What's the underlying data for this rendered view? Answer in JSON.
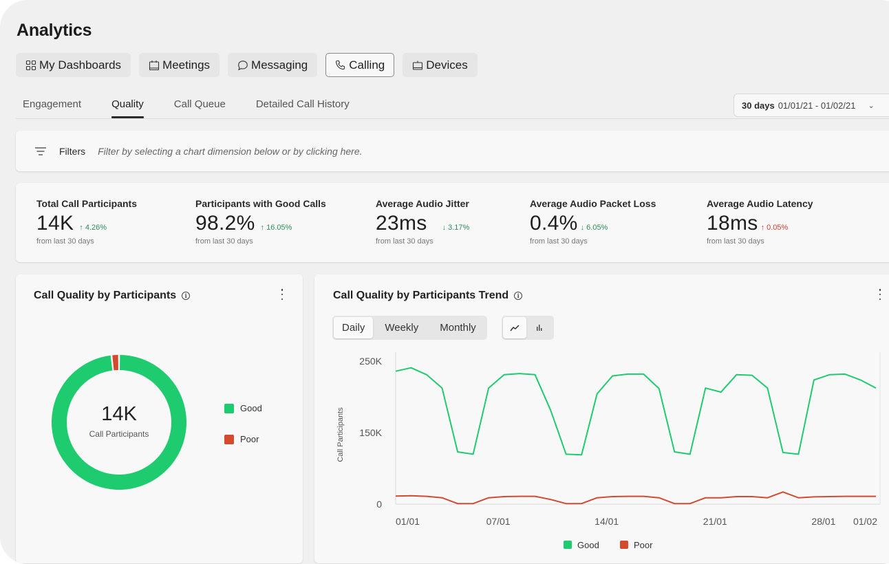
{
  "page": {
    "title": "Analytics"
  },
  "topnav": [
    {
      "label": "My Dashboards",
      "icon": "grid-icon",
      "active": false
    },
    {
      "label": "Meetings",
      "icon": "calendar-icon",
      "active": false
    },
    {
      "label": "Messaging",
      "icon": "chat-bubble-icon",
      "active": false
    },
    {
      "label": "Calling",
      "icon": "phone-icon",
      "active": true
    },
    {
      "label": "Devices",
      "icon": "device-icon",
      "active": false
    }
  ],
  "subtabs": [
    {
      "label": "Engagement",
      "active": false
    },
    {
      "label": "Quality",
      "active": true
    },
    {
      "label": "Call Queue",
      "active": false
    },
    {
      "label": "Detailed Call History",
      "active": false
    }
  ],
  "daterange": {
    "period": "30 days",
    "range": "01/01/21 - 01/02/21",
    "icon": "chevron-down-icon"
  },
  "filters": {
    "label": "Filters",
    "hint": "Filter by selecting a chart dimension below or by clicking here.",
    "icon": "filter-lines-icon"
  },
  "kpis": [
    {
      "label": "Total Call Participants",
      "value": "14K",
      "delta": "↑ 4.26%",
      "trend": "good",
      "sub": "from last 30 days"
    },
    {
      "label": "Participants with Good Calls",
      "value": "98.2%",
      "delta": "↑ 16.05%",
      "trend": "good",
      "sub": "from last 30 days"
    },
    {
      "label": "Average Audio Jitter",
      "value": "23ms",
      "delta": "↓ 3.17%",
      "trend": "good",
      "sub": "from last 30 days"
    },
    {
      "label": "Average Audio Packet Loss",
      "value": "0.4%",
      "delta": "↓ 6.05%",
      "trend": "good",
      "sub": "from last 30 days"
    },
    {
      "label": "Average Audio Latency",
      "value": "18ms",
      "delta": "↑ 0.05%",
      "trend": "bad",
      "sub": "from last 30 days"
    }
  ],
  "colors": {
    "good": "#1ecb6e",
    "poor": "#d44a2f",
    "delta_good": "#2e8b57",
    "delta_bad": "#c8412e"
  },
  "donut_card": {
    "title": "Call Quality by Participants",
    "center_value": "14K",
    "center_label": "Call Participants",
    "legend": [
      {
        "label": "Good",
        "color": "#1ecb6e"
      },
      {
        "label": "Poor",
        "color": "#d44a2f"
      }
    ]
  },
  "trend_card": {
    "title": "Call Quality by Participants Trend",
    "period_buttons": [
      {
        "label": "Daily",
        "active": true
      },
      {
        "label": "Weekly",
        "active": false
      },
      {
        "label": "Monthly",
        "active": false
      }
    ],
    "chart_type_buttons": [
      {
        "icon": "line-chart-icon",
        "active": true
      },
      {
        "icon": "bar-chart-icon",
        "active": false
      }
    ],
    "legend": [
      {
        "label": "Good",
        "color": "#1ecb6e"
      },
      {
        "label": "Poor",
        "color": "#d44a2f"
      }
    ]
  },
  "chart_data": [
    {
      "type": "pie",
      "title": "Call Quality by Participants",
      "categories": [
        "Good",
        "Poor"
      ],
      "values": [
        98.2,
        1.8
      ],
      "unit": "%",
      "center_text": "14K Call Participants",
      "legend": "right"
    },
    {
      "type": "line",
      "title": "Call Quality by Participants Trend",
      "xlabel": "",
      "ylabel": "Call Participants",
      "ylim": [
        0,
        250000
      ],
      "yticks": [
        0,
        150000,
        250000
      ],
      "ytick_labels": [
        "0",
        "150K",
        "250K"
      ],
      "xtick_labels": [
        "01/01",
        "07/01",
        "14/01",
        "21/01",
        "28/01",
        "01/02"
      ],
      "xtick_index": [
        0,
        6,
        13,
        20,
        27,
        31
      ],
      "x": [
        "01/01",
        "02/01",
        "03/01",
        "04/01",
        "05/01",
        "06/01",
        "07/01",
        "08/01",
        "09/01",
        "10/01",
        "11/01",
        "12/01",
        "13/01",
        "14/01",
        "15/01",
        "16/01",
        "17/01",
        "18/01",
        "19/01",
        "20/01",
        "21/01",
        "22/01",
        "23/01",
        "24/01",
        "25/01",
        "26/01",
        "27/01",
        "28/01",
        "29/01",
        "30/01",
        "31/01",
        "01/02"
      ],
      "grid": false,
      "legend": "bottom",
      "series": [
        {
          "name": "Good",
          "color": "#1ecb6e",
          "values": [
            229000,
            235000,
            223000,
            200000,
            90000,
            86000,
            200000,
            223000,
            225000,
            223000,
            162000,
            86000,
            85000,
            190000,
            221000,
            224000,
            224000,
            199000,
            90000,
            86000,
            200000,
            193000,
            223000,
            222000,
            200000,
            89000,
            86000,
            214000,
            223000,
            224000,
            214000,
            200000
          ]
        },
        {
          "name": "Poor",
          "color": "#d44a2f",
          "values": [
            14000,
            14500,
            13500,
            11000,
            1000,
            1000,
            11000,
            13000,
            13500,
            13500,
            8000,
            1000,
            1000,
            11000,
            13000,
            13500,
            13500,
            11000,
            1000,
            1000,
            11000,
            11000,
            13000,
            13000,
            11000,
            21000,
            11000,
            12500,
            13000,
            13500,
            13500,
            13500
          ]
        }
      ]
    }
  ]
}
